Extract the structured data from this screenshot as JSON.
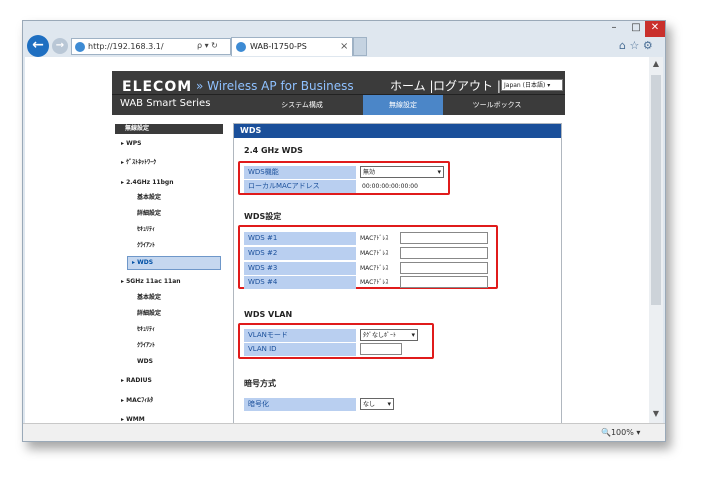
{
  "browser": {
    "window_controls": {
      "minimize": "–",
      "maximize": "□",
      "close": "✕"
    },
    "address": "http://192.168.3.1/",
    "address_controls": "ρ ▾ ↻",
    "tab_title": "WAB-I1750-PS",
    "tab_close": "×",
    "tool_icons": "⌂ ☆ ⚙",
    "zoom": "🔍100%  ▾",
    "back": "←",
    "forward": "→"
  },
  "header": {
    "logo": "ELECOM",
    "tagline": "» Wireless AP for Business",
    "home": "ホーム |",
    "logout": "ログアウト |",
    "language": "Japan (日本語)",
    "series": "WAB Smart Series",
    "nav": {
      "system": "システム構成",
      "wireless": "無線設定",
      "tools": "ツールボックス"
    }
  },
  "sidebar": {
    "title": "無線設定",
    "wps": "▸ WPS",
    "guest": "▸ ｹﾞｽﾄﾈｯﾄﾜｰｸ",
    "band24": "▸ 2.4GHz 11bgn",
    "b24_basic": "基本設定",
    "b24_detail": "詳細設定",
    "b24_security": "ｾｷｭﾘﾃｨ",
    "b24_client": "ｸﾗｲｱﾝﾄ",
    "b24_wds": "▸ WDS",
    "band5": "▸ 5GHz 11ac 11an",
    "b5_basic": "基本設定",
    "b5_detail": "詳細設定",
    "b5_security": "ｾｷｭﾘﾃｨ",
    "b5_client": "ｸﾗｲｱﾝﾄ",
    "b5_wds": "WDS",
    "radius": "▸ RADIUS",
    "macfilter": "▸ MACﾌｨﾙﾀ",
    "wmm": "▸ WMM"
  },
  "main": {
    "header": "WDS",
    "sec_24": "2.4 GHz WDS",
    "wds_func_label": "WDS機能",
    "wds_func_value": "無効",
    "local_mac_label": "ローカルMACアドレス",
    "local_mac_value": "00:00:00:00:00:00",
    "sec_wds_settings": "WDS設定",
    "wds1": "WDS #1",
    "wds2": "WDS #2",
    "wds3": "WDS #3",
    "wds4": "WDS #4",
    "mac_label": "MACｱﾄﾞﾚｽ",
    "sec_vlan": "WDS VLAN",
    "vlan_mode_label": "VLANモード",
    "vlan_mode_value": "ﾀｸﾞなしﾎﾟｰﾄ",
    "vlan_id_label": "VLAN ID",
    "sec_encryption": "暗号方式",
    "encrypt_label": "暗号化",
    "encrypt_value": "なし"
  }
}
